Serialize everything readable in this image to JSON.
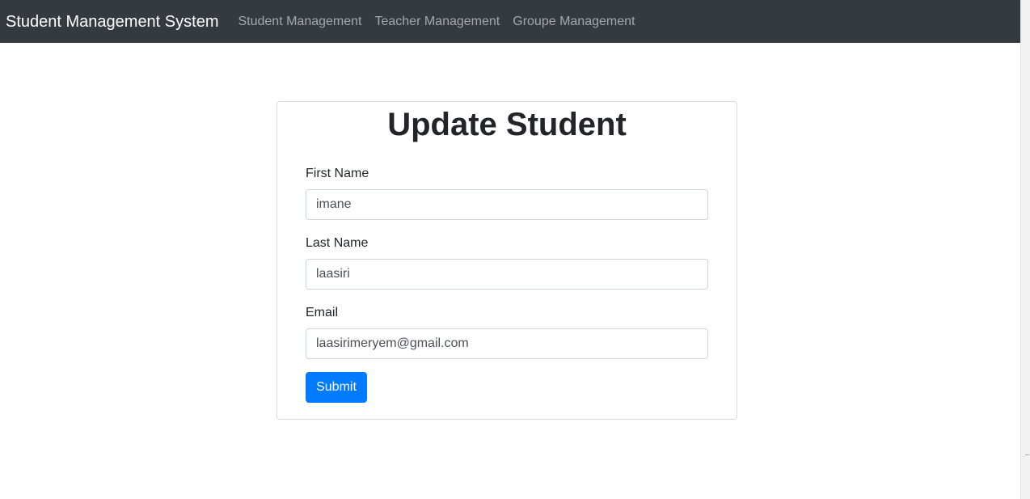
{
  "navbar": {
    "brand": "Student Management System",
    "links": [
      {
        "label": "Student Management"
      },
      {
        "label": "Teacher Management"
      },
      {
        "label": "Groupe Management"
      }
    ]
  },
  "form": {
    "title": "Update Student",
    "fields": {
      "first_name": {
        "label": "First Name",
        "value": "imane"
      },
      "last_name": {
        "label": "Last Name",
        "value": "laasiri"
      },
      "email": {
        "label": "Email",
        "value": "laasirimeryem@gmail.com"
      }
    },
    "submit_label": "Submit"
  },
  "colors": {
    "navbar_bg": "#343a40",
    "primary": "#007bff"
  }
}
